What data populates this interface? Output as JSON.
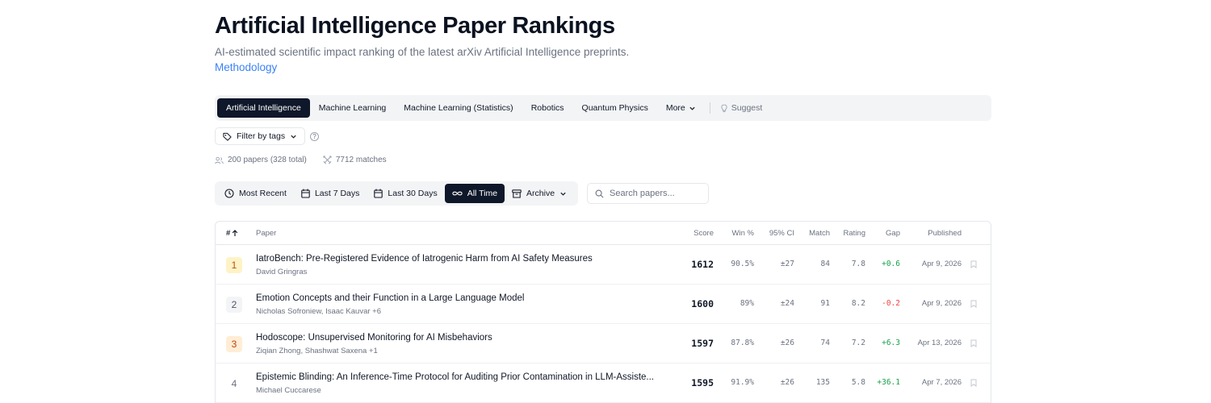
{
  "header": {
    "title": "Artificial Intelligence Paper Rankings",
    "subtitle": "AI-estimated scientific impact ranking of the latest arXiv Artificial Intelligence preprints.",
    "methodology_link": "Methodology"
  },
  "categories": {
    "items": [
      "Artificial Intelligence",
      "Machine Learning",
      "Machine Learning (Statistics)",
      "Robotics",
      "Quantum Physics"
    ],
    "active": "Artificial Intelligence",
    "more_label": "More",
    "suggest_label": "Suggest"
  },
  "filter": {
    "label": "Filter by tags",
    "help": "?"
  },
  "stats": {
    "papers": "200 papers (328 total)",
    "matches": "7712 matches"
  },
  "time_filters": {
    "items": [
      "Most Recent",
      "Last 7 Days",
      "Last 30 Days",
      "All Time"
    ],
    "active": "All Time",
    "archive_label": "Archive"
  },
  "search": {
    "placeholder": "Search papers..."
  },
  "table": {
    "columns": {
      "rank": "#",
      "paper": "Paper",
      "score": "Score",
      "win": "Win %",
      "ci": "95% CI",
      "match": "Match",
      "rating": "Rating",
      "gap": "Gap",
      "published": "Published"
    },
    "rows": [
      {
        "rank": "1",
        "title": "IatroBench: Pre-Registered Evidence of Iatrogenic Harm from AI Safety Measures",
        "authors": "David Gringras",
        "score": "1612",
        "win": "90.5%",
        "ci": "±27",
        "match": "84",
        "rating": "7.8",
        "gap": "+0.6",
        "published": "Apr 9, 2026"
      },
      {
        "rank": "2",
        "title": "Emotion Concepts and their Function in a Large Language Model",
        "authors": "Nicholas Sofroniew, Isaac Kauvar +6",
        "score": "1600",
        "win": "89%",
        "ci": "±24",
        "match": "91",
        "rating": "8.2",
        "gap": "-0.2",
        "published": "Apr 9, 2026"
      },
      {
        "rank": "3",
        "title": "Hodoscope: Unsupervised Monitoring for AI Misbehaviors",
        "authors": "Ziqian Zhong, Shashwat Saxena +1",
        "score": "1597",
        "win": "87.8%",
        "ci": "±26",
        "match": "74",
        "rating": "7.2",
        "gap": "+6.3",
        "published": "Apr 13, 2026"
      },
      {
        "rank": "4",
        "title": "Epistemic Blinding: An Inference-Time Protocol for Auditing Prior Contamination in LLM-Assiste...",
        "authors": "Michael Cuccarese",
        "score": "1595",
        "win": "91.9%",
        "ci": "±26",
        "match": "135",
        "rating": "5.8",
        "gap": "+36.1",
        "published": "Apr 7, 2026"
      }
    ]
  },
  "colors": {
    "accent_dark": "#0f172a",
    "link_blue": "#3b82f6",
    "rank1_bg": "#fef3c7",
    "rank1_fg": "#b45309",
    "rank3_bg": "#ffedd5",
    "rank3_fg": "#c2410c",
    "positive": "#16a34a",
    "negative": "#ef4444"
  }
}
